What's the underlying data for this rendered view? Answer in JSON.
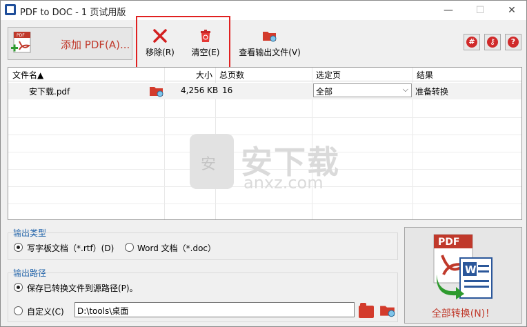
{
  "window": {
    "title": "PDF to DOC - 1 页试用版",
    "min_glyph": "—",
    "max_glyph": "☐",
    "close_glyph": "✕"
  },
  "toolbar": {
    "add_pdf_label": "添加 PDF(A)...",
    "remove_label": "移除(R)",
    "clear_label": "清空(E)",
    "view_output_label": "查看输出文件(V)",
    "right_icons": [
      "globe-icon",
      "key-icon",
      "help-icon"
    ],
    "help_glyph": "?"
  },
  "table": {
    "headers": {
      "name": "文件名▲",
      "size": "大小",
      "pages": "总页数",
      "selected": "选定页",
      "result": "结果"
    },
    "rows": [
      {
        "name": "安下载.pdf",
        "size": "4,256 KB",
        "pages": "16",
        "selected": "全部",
        "result": "准备转换"
      }
    ]
  },
  "watermark": {
    "text": "安下载",
    "sub": "anxz.com"
  },
  "output_type": {
    "label": "输出类型",
    "options": [
      {
        "label": "写字板文档（*.rtf）(D)",
        "selected": true
      },
      {
        "label": "Word 文档（*.doc）",
        "selected": false
      }
    ]
  },
  "output_path": {
    "label": "输出路径",
    "options": [
      {
        "label": "保存已转换文件到源路径(P)。",
        "selected": true
      },
      {
        "label": "自定义(C)",
        "selected": false
      }
    ],
    "custom_path_value": "D:\\tools\\桌面"
  },
  "convert": {
    "label": "全部转换(N)！"
  },
  "colors": {
    "accent_red": "#c0392b",
    "highlight_box": "#e02020",
    "group_label_blue": "#1a5fa8"
  }
}
